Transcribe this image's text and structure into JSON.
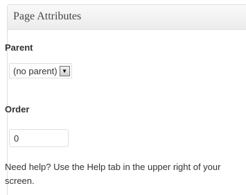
{
  "panel": {
    "title": "Page Attributes"
  },
  "parent": {
    "label": "Parent",
    "selected": "(no parent)",
    "arrow_icon": "dropdown-arrow-icon"
  },
  "order": {
    "label": "Order",
    "value": "0"
  },
  "help": {
    "text": "Need help? Use the Help tab in the upper right of your screen."
  }
}
